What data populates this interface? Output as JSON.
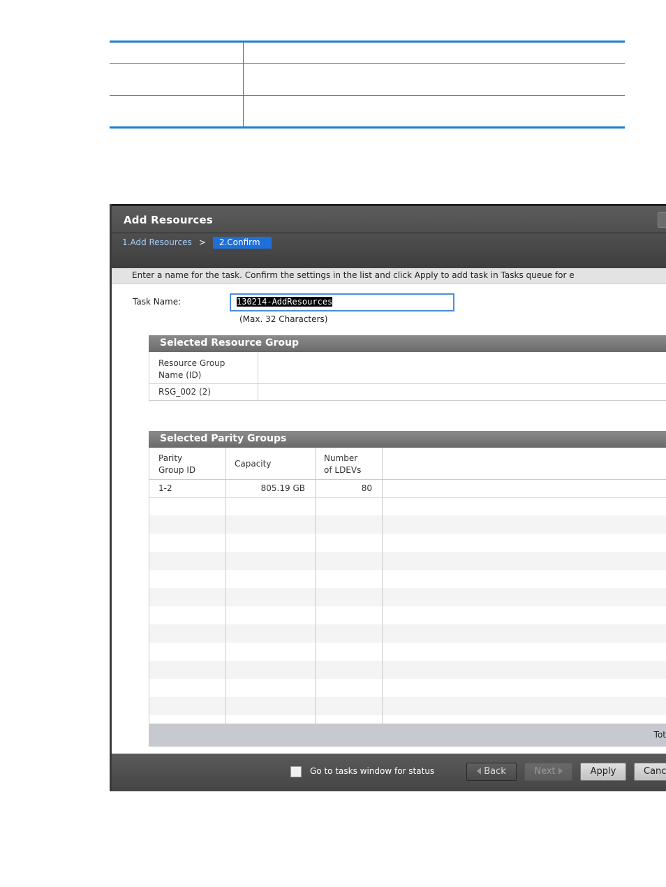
{
  "window": {
    "title": "Add Resources",
    "breadcrumb": {
      "step1": "1.Add Resources",
      "separator": ">",
      "step2": "2.Confirm"
    },
    "instruction": "Enter a name for the task. Confirm the settings in the list and click Apply to add task in Tasks queue for e"
  },
  "task": {
    "label": "Task Name:",
    "value": "130214-AddResources",
    "hint": "(Max. 32 Characters)"
  },
  "resource_group": {
    "title": "Selected Resource Group",
    "header_line1": "Resource Group",
    "header_line2": "Name (ID)",
    "row": "RSG_002 (2)"
  },
  "parity_groups": {
    "title": "Selected Parity Groups",
    "columns": [
      {
        "line1": "Parity",
        "line2": "Group ID"
      },
      {
        "line1": "Capacity",
        "line2": ""
      },
      {
        "line1": "Number",
        "line2": "of LDEVs"
      }
    ],
    "rows": [
      {
        "id": "1-2",
        "capacity": "805.19 GB",
        "ldevs": "80"
      }
    ],
    "total_label": "Tot"
  },
  "footer": {
    "checkbox_label": "Go to tasks window for status",
    "back": "Back",
    "next": "Next",
    "apply": "Apply",
    "cancel": "Canc"
  }
}
